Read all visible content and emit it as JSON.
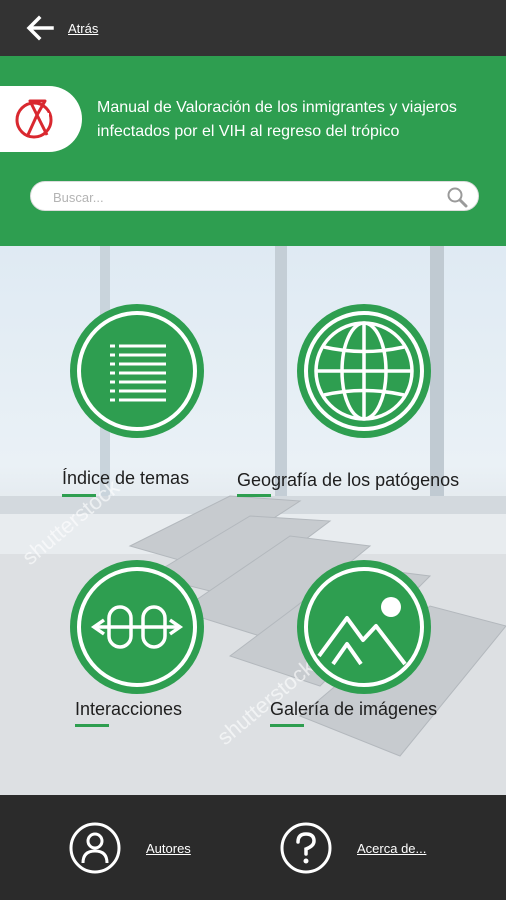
{
  "topbar": {
    "back_label": "Atrás"
  },
  "header": {
    "title": "Manual de Valoración de los inmigrantes y viajeros infectados por el VIH al regreso del trópico",
    "search_placeholder": "Buscar..."
  },
  "menu": {
    "items": [
      {
        "label": "Índice de temas",
        "icon": "list-icon"
      },
      {
        "label": "Geografía de los patógenos",
        "icon": "globe-icon"
      },
      {
        "label": "Interacciones",
        "icon": "interactions-icon"
      },
      {
        "label": "Galería de imágenes",
        "icon": "image-gallery-icon"
      }
    ]
  },
  "watermark": "shutterstock",
  "bottombar": {
    "authors_label": "Autores",
    "about_label": "Acerca de..."
  },
  "colors": {
    "brand_green": "#2e9e50",
    "bar_dark": "#333333",
    "logo_red": "#d9282f"
  }
}
